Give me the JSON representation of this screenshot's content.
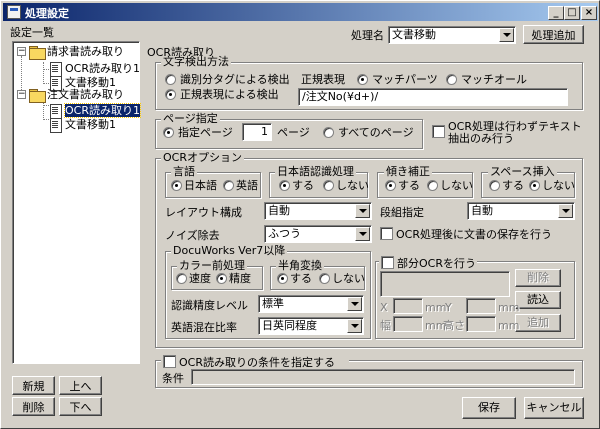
{
  "window": {
    "title": "処理設定",
    "min": "_",
    "max": "□",
    "close": "×"
  },
  "left": {
    "heading": "設定一覧",
    "tree": [
      {
        "label": "請求書読み取り",
        "children": [
          "OCR読み取り1",
          "文書移動1"
        ]
      },
      {
        "label": "注文書読み取り",
        "children": [
          "OCR読み取り1",
          "文書移動1"
        ]
      }
    ],
    "buttons": {
      "new": "新規",
      "up": "上へ",
      "delete": "削除",
      "down": "下へ"
    }
  },
  "header": {
    "proc_name_label": "処理名",
    "proc_name_value": "文書移動",
    "add_button": "処理追加"
  },
  "section_title": "OCR読み取り",
  "text_detect": {
    "group": "文字検出方法",
    "opt_separator": "識別分タグによる検出",
    "opt_regex": "正規表現による検出",
    "regex_label": "正規表現",
    "match_parts": "マッチパーツ",
    "match_all": "マッチオール",
    "regex_value": "/注文No(¥d+)/"
  },
  "page": {
    "group": "ページ指定",
    "opt_page": "指定ページ",
    "page_value": "1",
    "page_unit": "ページ",
    "opt_all": "すべてのページ",
    "text_only_check": "OCR処理は行わずテキスト抽出のみ行う"
  },
  "ocr": {
    "group": "OCRオプション",
    "lang_group": "言語",
    "lang_ja": "日本語",
    "lang_en": "英語",
    "jpn_group": "日本語認識処理",
    "jpn_do": "する",
    "jpn_dont": "しない",
    "tilt_group": "傾き補正",
    "tilt_do": "する",
    "tilt_dont": "しない",
    "space_group": "スペース挿入",
    "space_do": "する",
    "space_dont": "しない",
    "layout_label": "レイアウト構成",
    "layout_value": "自動",
    "column_label": "段組指定",
    "column_value": "自動",
    "noise_label": "ノイズ除去",
    "noise_value": "ふつう",
    "save_after_check": "OCR処理後に文書の保存を行う"
  },
  "docuworks": {
    "group": "DocuWorks Ver7以降",
    "color_group": "カラー前処理",
    "color_speed": "速度",
    "color_accuracy": "精度",
    "halfwidth_group": "半角変換",
    "half_do": "する",
    "half_dont": "しない",
    "accuracy_label": "認識精度レベル",
    "accuracy_value": "標準",
    "english_label": "英語混在比率",
    "english_value": "日英同程度"
  },
  "partial": {
    "check": "部分OCRを行う",
    "delete_btn": "削除",
    "read_btn": "読込",
    "add_btn": "追加",
    "x": "X",
    "y": "Y",
    "w": "幅",
    "h": "高さ",
    "unit": "mm"
  },
  "condition": {
    "check": "OCR読み取りの条件を指定する",
    "label": "条件",
    "value": ""
  },
  "footer": {
    "save": "保存",
    "cancel": "キャンセル"
  }
}
